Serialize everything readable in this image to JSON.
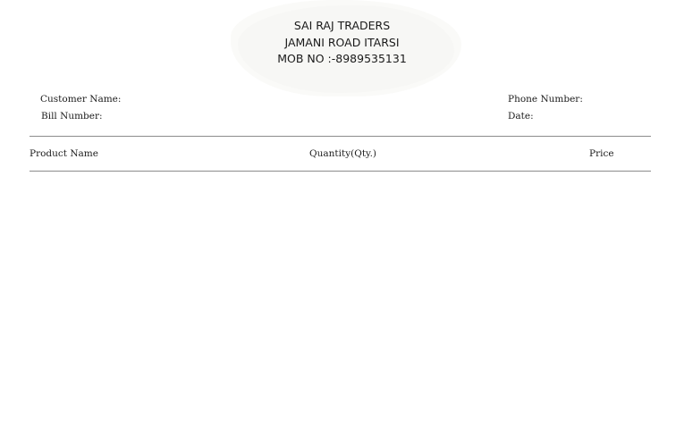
{
  "shop": {
    "name": "SAI RAJ TRADERS",
    "address": "JAMANI ROAD ITARSI",
    "mobile": "MOB NO :-8989535131"
  },
  "bill_fields": {
    "customer_name_label": "Customer Name:",
    "bill_number_label": "Bill Number:",
    "phone_number_label": "Phone Number:",
    "date_label": "Date:"
  },
  "table": {
    "columns": [
      "Product Name",
      "Quantity(Qty.)",
      "Price"
    ]
  },
  "colors": {
    "rule": "#8c8c8c",
    "text": "#1c1c1c",
    "logo_background": "#f7f7f5"
  }
}
